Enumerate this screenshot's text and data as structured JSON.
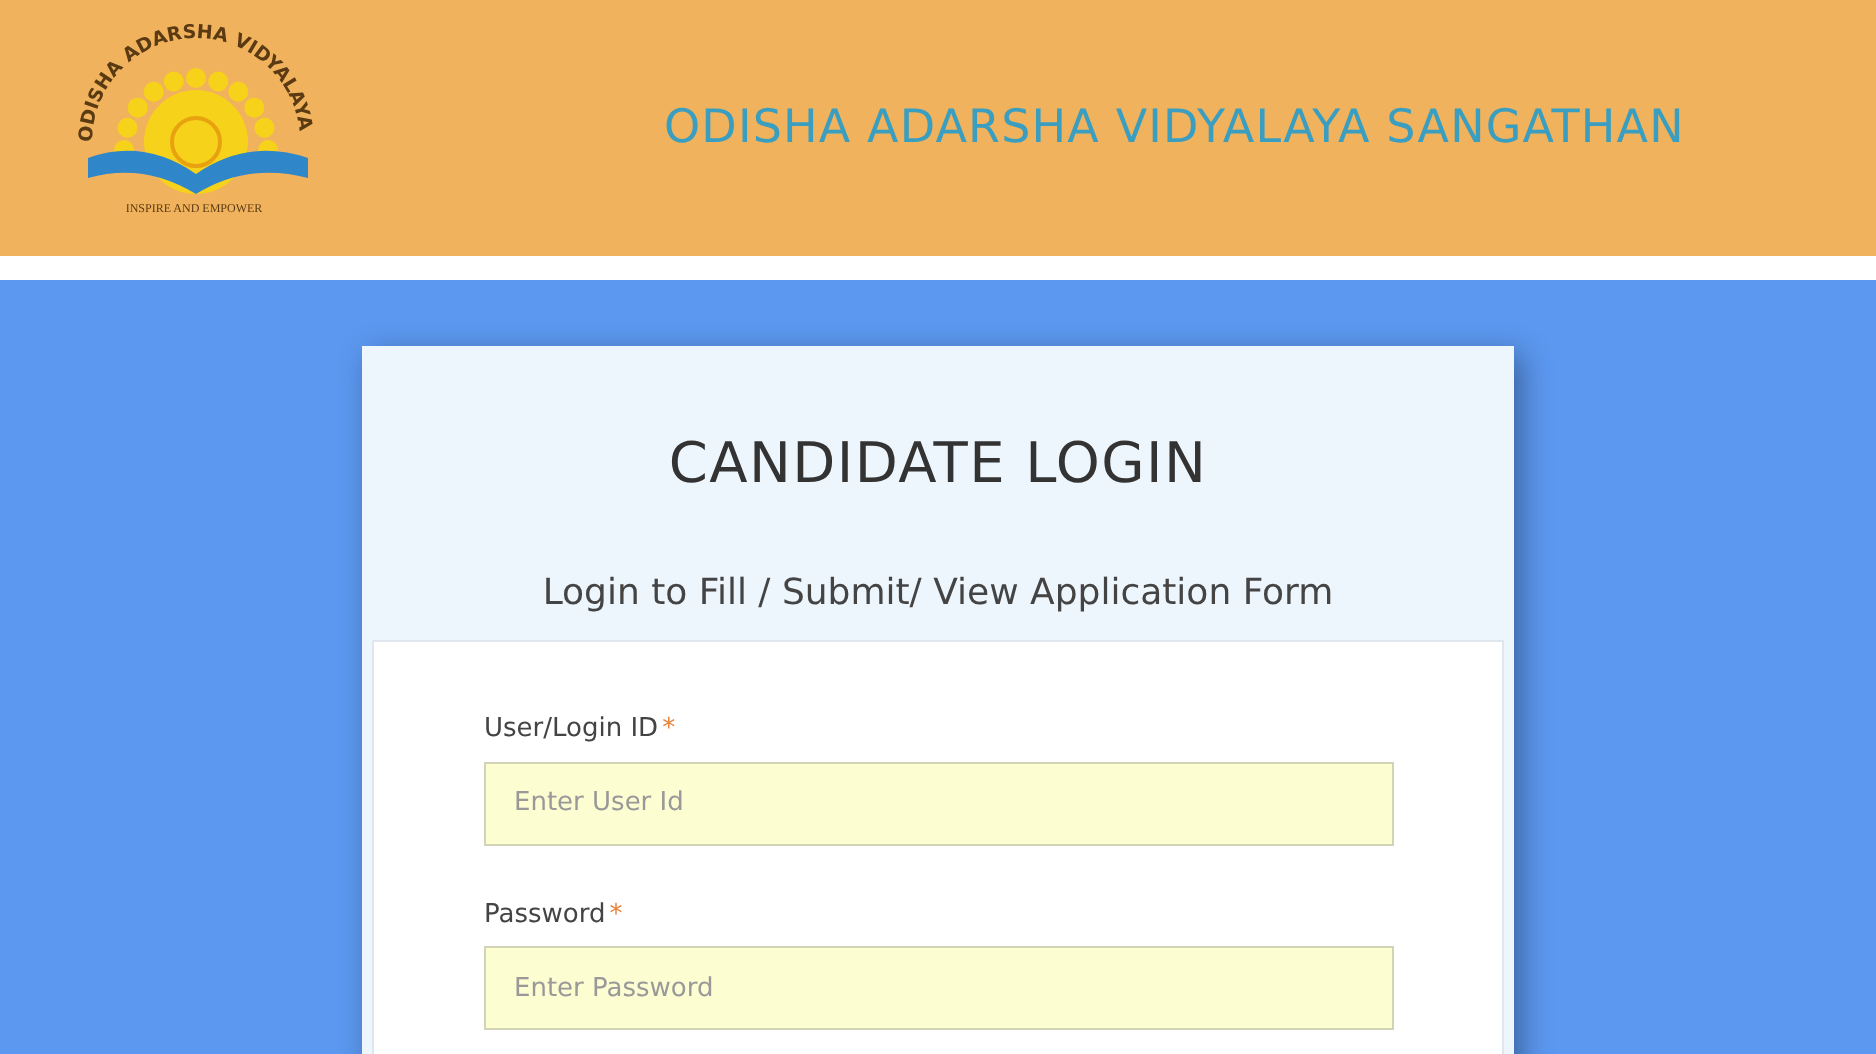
{
  "header": {
    "logo": {
      "arc_text": "ODISHA ADARSHA VIDYALAYA",
      "motto": "INSPIRE AND EMPOWER"
    },
    "title": "ODISHA ADARSHA VIDYALAYA SANGATHAN"
  },
  "card": {
    "title": "CANDIDATE LOGIN",
    "subtitle": "Login to Fill / Submit/ View Application Form",
    "fields": [
      {
        "label": "User/Login ID",
        "required_mark": "*",
        "placeholder": "Enter User Id"
      },
      {
        "label": "Password",
        "required_mark": "*",
        "placeholder": "Enter Password"
      }
    ]
  }
}
